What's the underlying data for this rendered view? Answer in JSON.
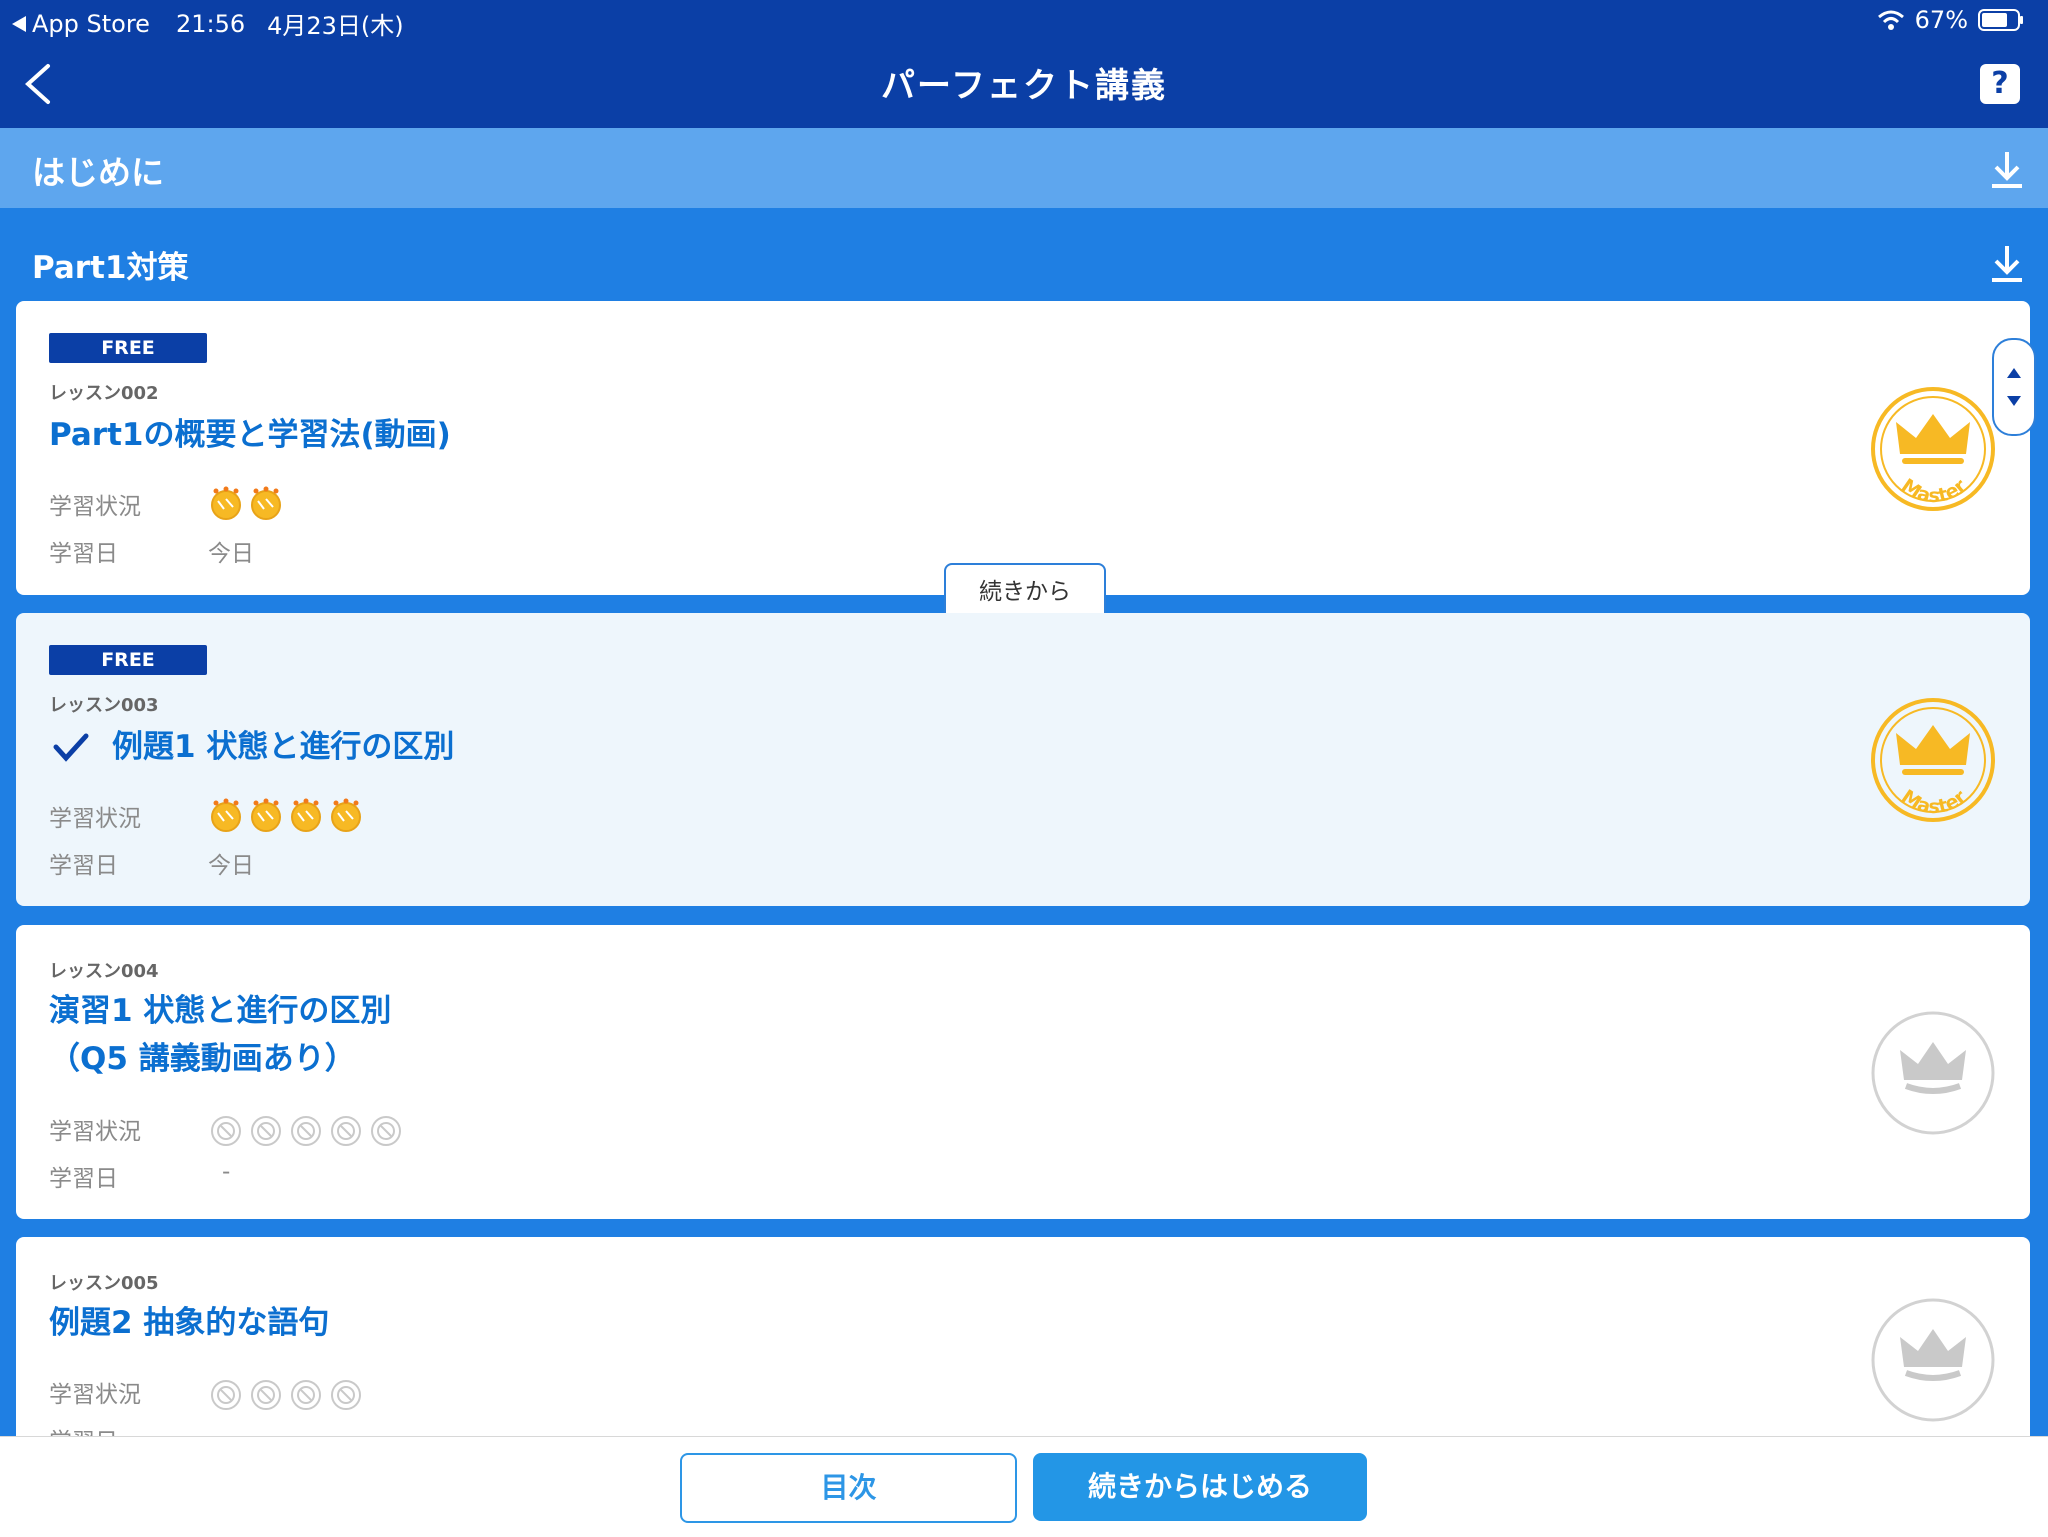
{
  "status_bar": {
    "back_app": "App Store",
    "time": "21:56",
    "date": "4月23日(木)",
    "battery": "67%"
  },
  "nav": {
    "title": "パーフェクト講義",
    "help_label": "?"
  },
  "sections": [
    {
      "label": "はじめに"
    },
    {
      "label": "Part1対策"
    }
  ],
  "lessons": [
    {
      "badge": "FREE",
      "number": "レッスン002",
      "title_line1": "Part1の概要と学習法(動画)",
      "status_label": "学習状況",
      "date_label": "学習日",
      "date_value": "今日",
      "stars_total": 2,
      "stars_done": 2,
      "mastered": true,
      "crown_text": "Master"
    },
    {
      "badge": "FREE",
      "number": "レッスン003",
      "title_line1": "例題1 状態と進行の区別",
      "status_label": "学習状況",
      "date_label": "学習日",
      "date_value": "今日",
      "stars_total": 4,
      "stars_done": 4,
      "mastered": true,
      "checked": true,
      "crown_text": "Master"
    },
    {
      "number": "レッスン004",
      "title_line1": "演習1 状態と進行の区別",
      "title_line2": "（Q5 講義動画あり）",
      "status_label": "学習状況",
      "date_label": "学習日",
      "date_value": "-",
      "stars_total": 5,
      "stars_done": 0,
      "mastered": false
    },
    {
      "number": "レッスン005",
      "title_line1": "例題2 抽象的な語句",
      "status_label": "学習状況",
      "date_label": "学習日",
      "stars_total": 4,
      "stars_done": 0,
      "mastered": false
    }
  ],
  "tooltip": {
    "label": "続きから"
  },
  "bottom": {
    "toc_label": "目次",
    "resume_label": "続きからはじめる"
  },
  "colors": {
    "nav_bg": "#0b3fa6",
    "section_light": "#5ea6ee",
    "section_main": "#1f7fe3",
    "title_blue": "#0b6fd0",
    "gold": "#f7b924",
    "gray_icon": "#c9c9c9"
  }
}
